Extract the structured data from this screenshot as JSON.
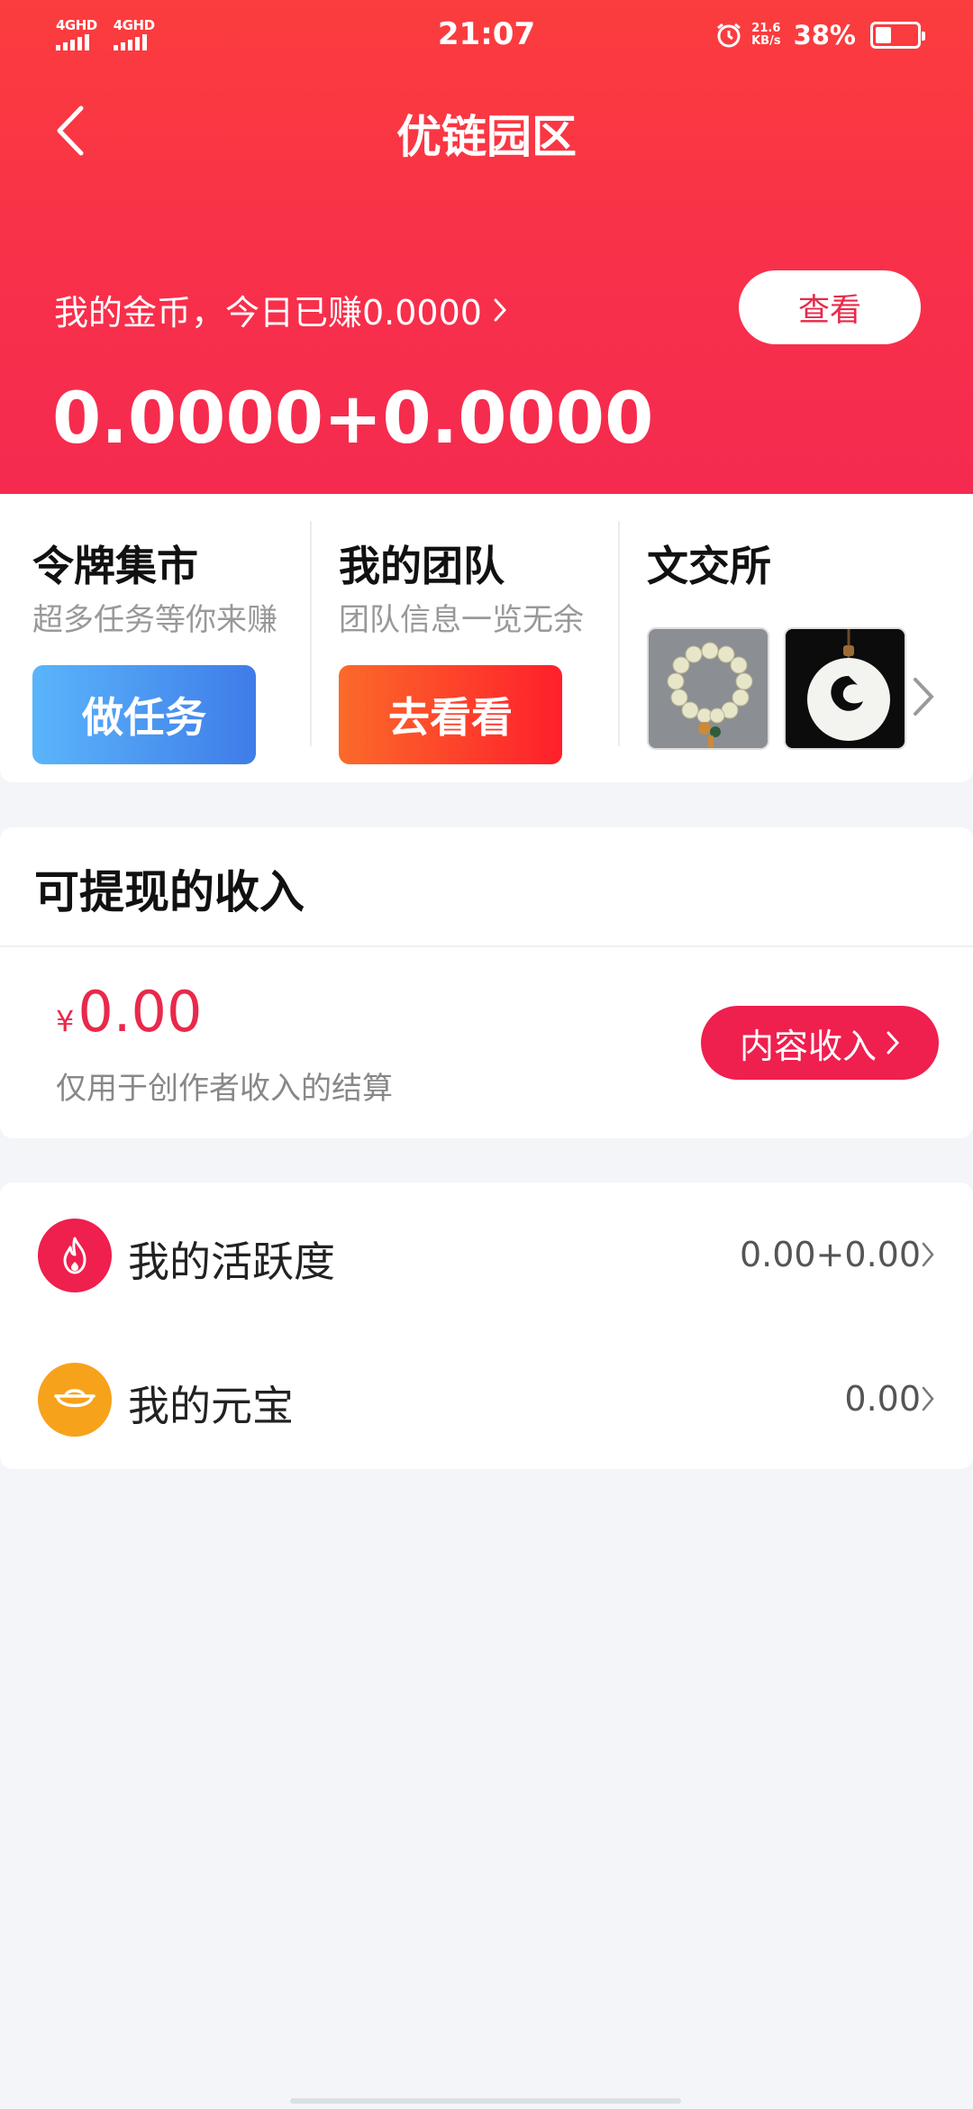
{
  "status_bar": {
    "net1": "4GHD",
    "net2": "4GHD",
    "time": "21:07",
    "speed_value": "21.6",
    "speed_unit": "KB/s",
    "battery_pct": "38%",
    "battery_level": 0.38
  },
  "header": {
    "title": "优链园区",
    "coins_line": "我的金币，今日已赚0.0000",
    "view_label": "查看",
    "coins_total": "0.0000+0.0000"
  },
  "features": [
    {
      "title": "令牌集市",
      "subtitle": "超多任务等你来赚",
      "button": "做任务"
    },
    {
      "title": "我的团队",
      "subtitle": "团队信息一览无余",
      "button": "去看看"
    },
    {
      "title": "文交所"
    }
  ],
  "income": {
    "title": "可提现的收入",
    "currency": "¥",
    "amount": "0.00",
    "note": "仅用于创作者收入的结算",
    "button": "内容收入"
  },
  "stats": [
    {
      "label": "我的活跃度",
      "value": "0.00+0.00",
      "icon": "flame-icon",
      "color": "#ef1f4e"
    },
    {
      "label": "我的元宝",
      "value": "0.00",
      "icon": "ingot-icon",
      "color": "#f7a21b"
    }
  ]
}
